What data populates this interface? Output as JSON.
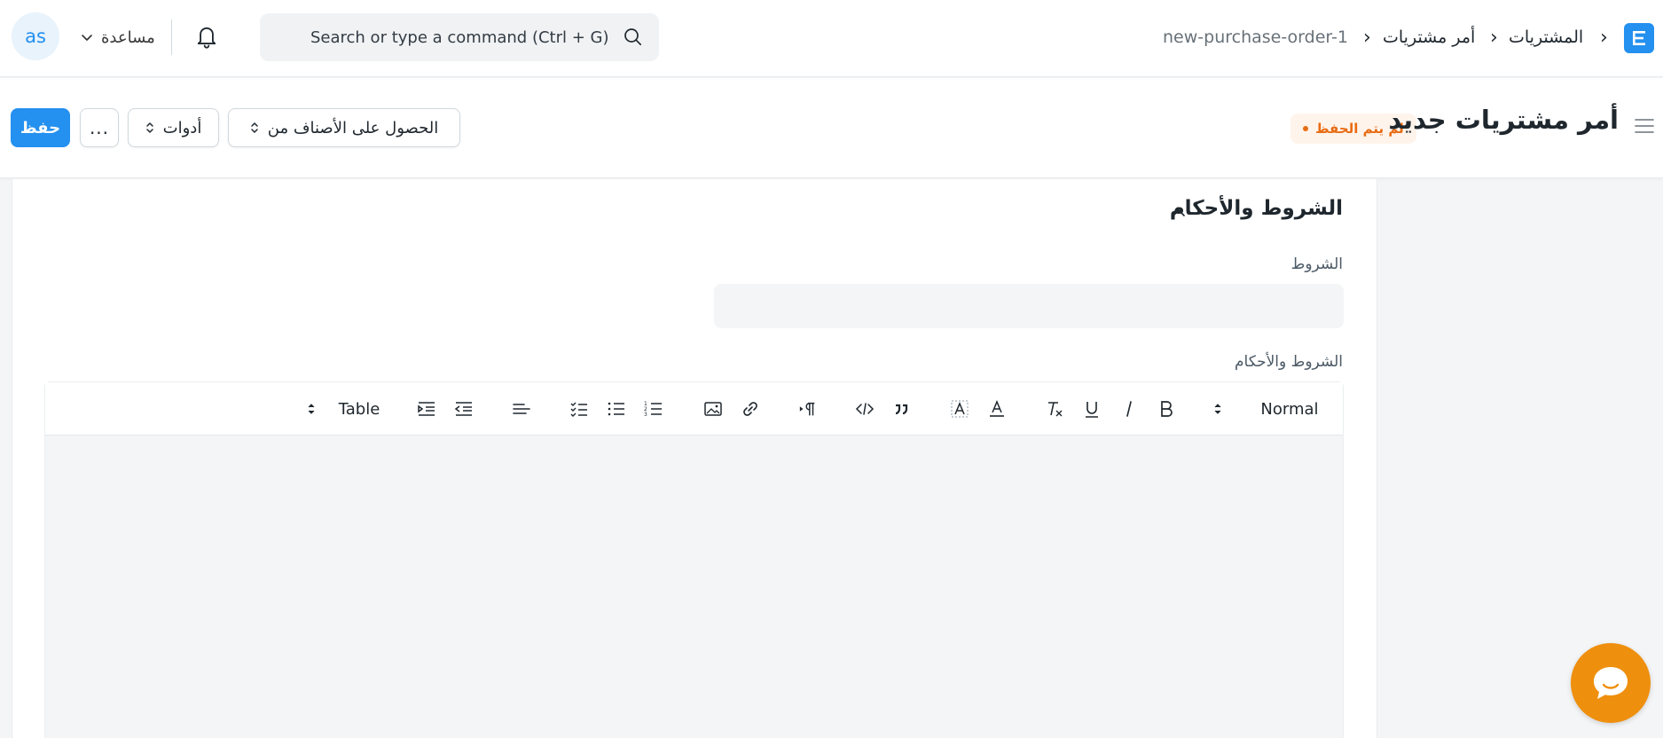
{
  "navbar": {
    "avatar_initials": "as",
    "help_label": "مساعدة",
    "search_placeholder": "Search or type a command (Ctrl + G)",
    "breadcrumbs": [
      "المشتريات",
      "أمر مشتريات",
      "new-purchase-order-1"
    ],
    "logo_letter": "E"
  },
  "pagehead": {
    "title": "أمر مشتريات جديد",
    "status_badge": "لم يتم الحفظ",
    "save_label": "حفظ",
    "more_label": "...",
    "tools_label": "أدوات",
    "get_items_label": "الحصول على الأصناف من"
  },
  "section": {
    "title": "الشروط والأحكام",
    "terms_label": "الشروط",
    "terms_value": "",
    "tc_label": "الشروط والأحكام"
  },
  "editor": {
    "format_select": "Normal",
    "table_label": "Table"
  },
  "colors": {
    "primary": "#2490ef",
    "badge_text": "#e86c13",
    "badge_bg": "#fff4ec",
    "chat": "#ef8f0e"
  }
}
